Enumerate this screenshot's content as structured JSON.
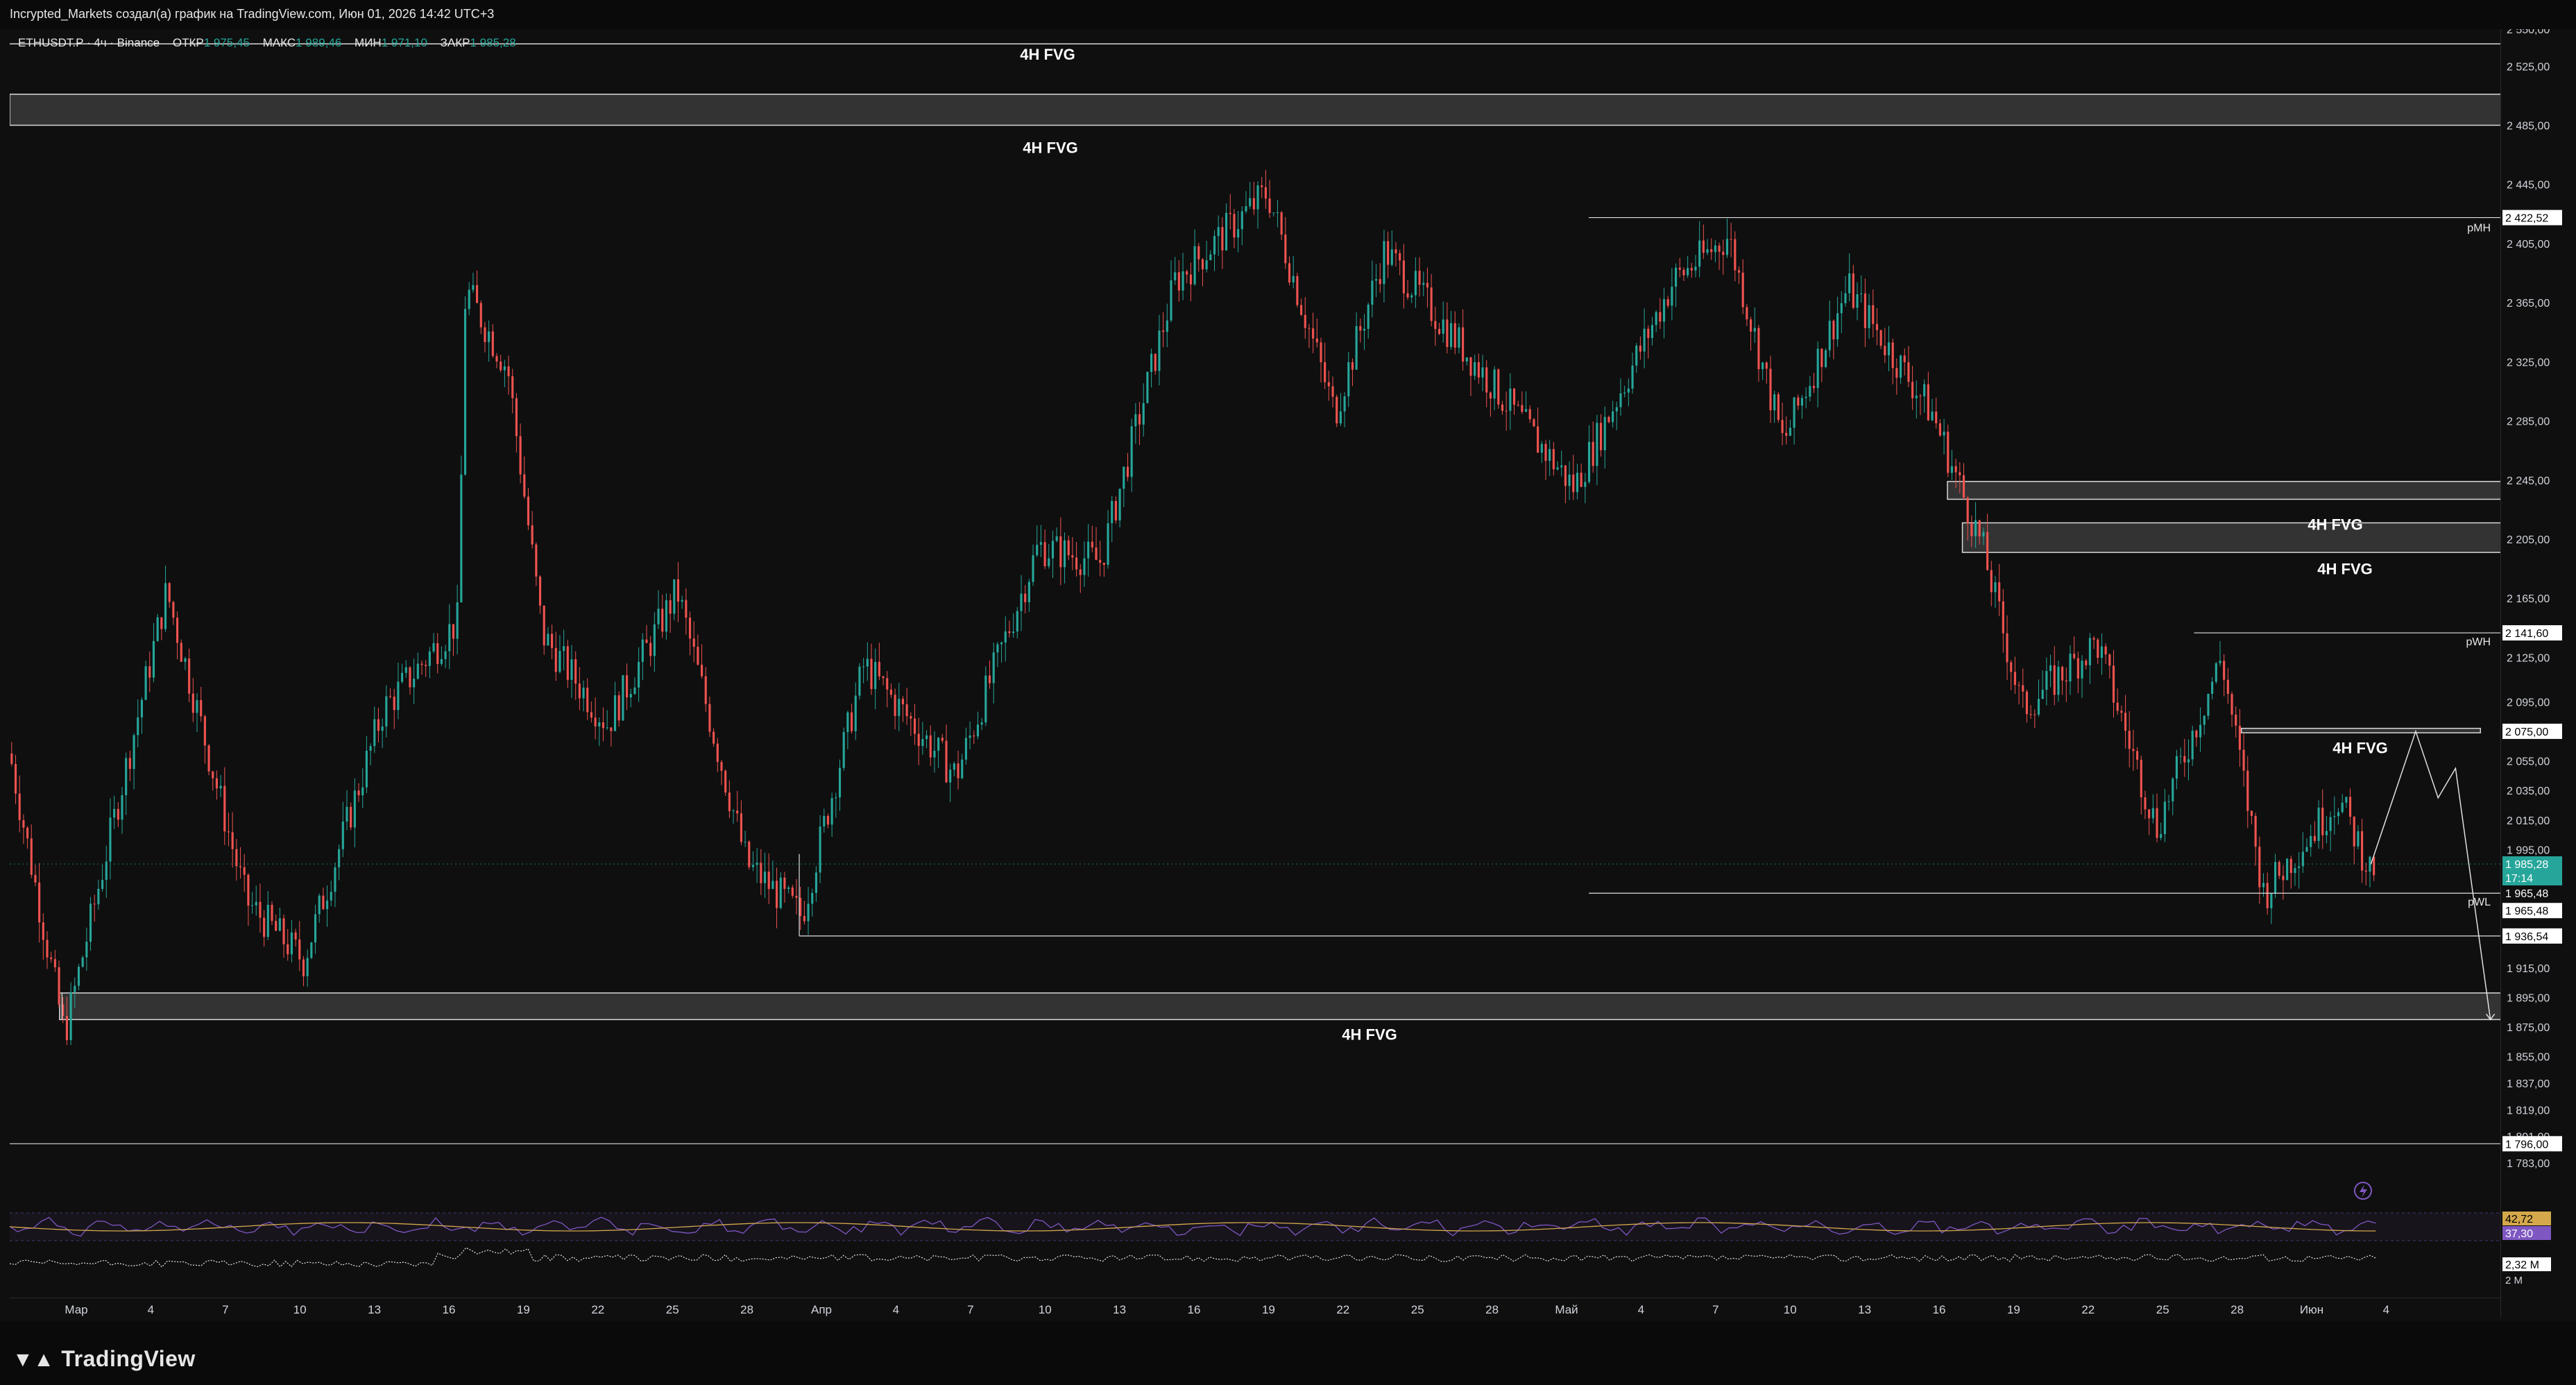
{
  "header": {
    "caption": "Incrypted_Markets создал(а) график на TradingView.com, Июн 01, 2026 14:42 UTC+3"
  },
  "legend": {
    "symbol": "ETHUSDT.P · 4ч · Binance",
    "open_label": "ОТКР",
    "open_value": "1 975,45",
    "high_label": "МАКС",
    "high_value": "1 989,46",
    "low_label": "МИН",
    "low_value": "1 971,10",
    "close_label": "ЗАКР",
    "close_value": "1 985,28"
  },
  "annotations": {
    "fvg_label": "4H FVG",
    "pmh": "pMH",
    "pwh": "pWH",
    "pwl": "pWL"
  },
  "price_axis": {
    "ticks": [
      "2 550,00",
      "2 525,00",
      "2 485,00",
      "2 445,00",
      "2 405,00",
      "2 365,00",
      "2 325,00",
      "2 285,00",
      "2 245,00",
      "2 205,00",
      "2 165,00",
      "2 125,00",
      "2 095,00",
      "2 055,00",
      "2 035,00",
      "2 015,00",
      "1 995,00",
      "1 915,00",
      "1 895,00",
      "1 875,00",
      "1 855,00",
      "1 837,00",
      "1 819,00",
      "1 801,00",
      "1 783,00"
    ],
    "tick_values": [
      2550,
      2525,
      2485,
      2445,
      2405,
      2365,
      2325,
      2285,
      2245,
      2205,
      2165,
      2125,
      2095,
      2055,
      2035,
      2015,
      1995,
      1915,
      1895,
      1875,
      1855,
      1837,
      1819,
      1801,
      1783
    ],
    "tag_pmh": "2 422,52",
    "tag_pwh": "2 141,60",
    "tag_2075": "2 075,00",
    "tag_current": "1 985,28",
    "tag_countdown": "17:14",
    "tag_pwl_a": "1 965,48",
    "tag_pwl_b": "1 965,48",
    "tag_low": "1 936,54",
    "tag_1796": "1 796,00",
    "rsi_a": "42,72",
    "rsi_b": "37,30",
    "vol_value": "2,32 M",
    "vol_scale": "2 M"
  },
  "time_axis": {
    "labels": [
      "Мар",
      "4",
      "7",
      "10",
      "13",
      "16",
      "19",
      "22",
      "25",
      "28",
      "Апр",
      "4",
      "7",
      "10",
      "13",
      "16",
      "19",
      "22",
      "25",
      "28",
      "Май",
      "4",
      "7",
      "10",
      "13",
      "16",
      "19",
      "22",
      "25",
      "28",
      "Июн",
      "4"
    ]
  },
  "footer": {
    "brand": "TradingView"
  },
  "colors": {
    "up": "#26a69a",
    "down": "#ef5350",
    "background": "#0f0f0f",
    "fvg_fill": "#3a3a3a",
    "rsi_line": "#7e57c2",
    "rsi_ma": "#d4a84b"
  },
  "chart_data": {
    "type": "candlestick",
    "symbol": "ETHUSDT.P",
    "timeframe": "4ч",
    "ylim": [
      1783,
      2550
    ],
    "anchor_prices": [
      {
        "t": 0.0,
        "p": 2060
      },
      {
        "t": 0.022,
        "p": 1870
      },
      {
        "t": 0.063,
        "p": 2170
      },
      {
        "t": 0.095,
        "p": 1960
      },
      {
        "t": 0.118,
        "p": 1920
      },
      {
        "t": 0.15,
        "p": 2090
      },
      {
        "t": 0.18,
        "p": 2150
      },
      {
        "t": 0.183,
        "p": 2375
      },
      {
        "t": 0.2,
        "p": 2320
      },
      {
        "t": 0.214,
        "p": 2140
      },
      {
        "t": 0.24,
        "p": 2080
      },
      {
        "t": 0.268,
        "p": 2170
      },
      {
        "t": 0.296,
        "p": 1985
      },
      {
        "t": 0.318,
        "p": 1950
      },
      {
        "t": 0.343,
        "p": 2120
      },
      {
        "t": 0.38,
        "p": 2045
      },
      {
        "t": 0.413,
        "p": 2200
      },
      {
        "t": 0.438,
        "p": 2190
      },
      {
        "t": 0.468,
        "p": 2380
      },
      {
        "t": 0.505,
        "p": 2440
      },
      {
        "t": 0.532,
        "p": 2290
      },
      {
        "t": 0.552,
        "p": 2400
      },
      {
        "t": 0.595,
        "p": 2310
      },
      {
        "t": 0.628,
        "p": 2240
      },
      {
        "t": 0.668,
        "p": 2380
      },
      {
        "t": 0.69,
        "p": 2410
      },
      {
        "t": 0.712,
        "p": 2270
      },
      {
        "t": 0.738,
        "p": 2375
      },
      {
        "t": 0.772,
        "p": 2290
      },
      {
        "t": 0.792,
        "p": 2200
      },
      {
        "t": 0.808,
        "p": 2090
      },
      {
        "t": 0.838,
        "p": 2135
      },
      {
        "t": 0.862,
        "p": 2010
      },
      {
        "t": 0.888,
        "p": 2125
      },
      {
        "t": 0.905,
        "p": 1965
      },
      {
        "t": 0.935,
        "p": 2030
      },
      {
        "t": 0.948,
        "p": 1980
      },
      {
        "t": 0.95,
        "p": 1985.28
      }
    ],
    "ohlc_last": {
      "open": 1975.45,
      "high": 1989.46,
      "low": 1971.1,
      "close": 1985.28
    },
    "levels": [
      {
        "label": "pMH",
        "price": 2422.52
      },
      {
        "label": "pWH",
        "price": 2141.6
      },
      {
        "label": "pWL",
        "price": 1965.48
      },
      {
        "label": "",
        "price": 1936.54
      }
    ],
    "fvg_zones": [
      {
        "label": "4H FVG",
        "low": 2485,
        "high": 2506
      },
      {
        "label": "4H FVG",
        "low": 2232,
        "high": 2244
      },
      {
        "label": "4H FVG",
        "low": 2196,
        "high": 2216
      },
      {
        "label": "4H FVG",
        "low": 2074,
        "high": 2077
      },
      {
        "label": "4H FVG",
        "low": 1880,
        "high": 1898
      }
    ],
    "projection": [
      {
        "t": 0.948,
        "p": 1985
      },
      {
        "t": 0.966,
        "p": 2075
      },
      {
        "t": 0.975,
        "p": 2030
      },
      {
        "t": 0.982,
        "p": 2050
      },
      {
        "t": 0.996,
        "p": 1880
      }
    ],
    "rsi": {
      "value": 42.72,
      "ma": 37.3
    },
    "volume": {
      "value": "2,32 M"
    }
  }
}
